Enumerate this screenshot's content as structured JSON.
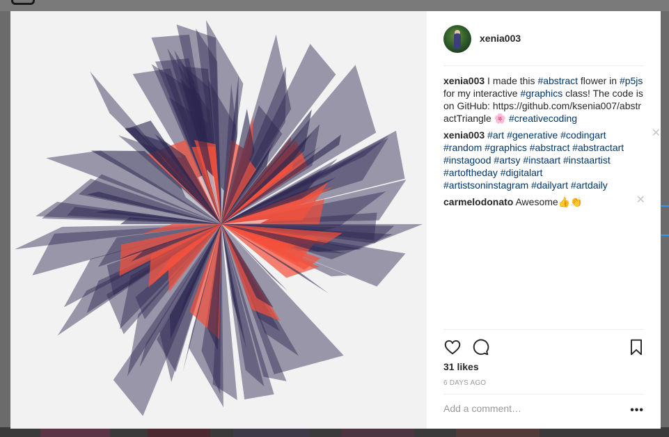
{
  "post": {
    "username": "xenia003",
    "likes": "31 likes",
    "time": "6 DAYS AGO",
    "comment_placeholder": "Add a comment…"
  },
  "caption": {
    "username": "xenia003",
    "t1": " I made this ",
    "tag1": "#abstract",
    "t2": " flower in ",
    "tag2": "#p5js",
    "t3": " for my interactive ",
    "tag3": "#graphics",
    "t4": " class! The code is on GitHub: https://github.com/ksenia007/abstractTriangle ",
    "emoji": "🌸",
    "t5": " ",
    "tag4": "#creativecoding"
  },
  "comment_tags": {
    "username": "xenia003",
    "tags": [
      "#art",
      "#generative",
      "#codingart",
      "#random",
      "#graphics",
      "#abstract",
      "#abstractart",
      "#instagood",
      "#artsy",
      "#instaart",
      "#instaartist",
      "#artoftheday",
      "#digitalart",
      "#artistsoninstagram",
      "#dailyart",
      "#artdaily"
    ],
    "close": "✕"
  },
  "comment_reply": {
    "username": "carmelodonato",
    "text": " Awesome👍👏",
    "close": "✕"
  },
  "icons": [
    "heart-icon",
    "comment-icon",
    "bookmark-icon",
    "more-icon",
    "close-icon"
  ],
  "colors": {
    "accent": "#3897f0",
    "hashtag": "#003569",
    "purple": "#2c2650",
    "coral": "#f4503c"
  }
}
